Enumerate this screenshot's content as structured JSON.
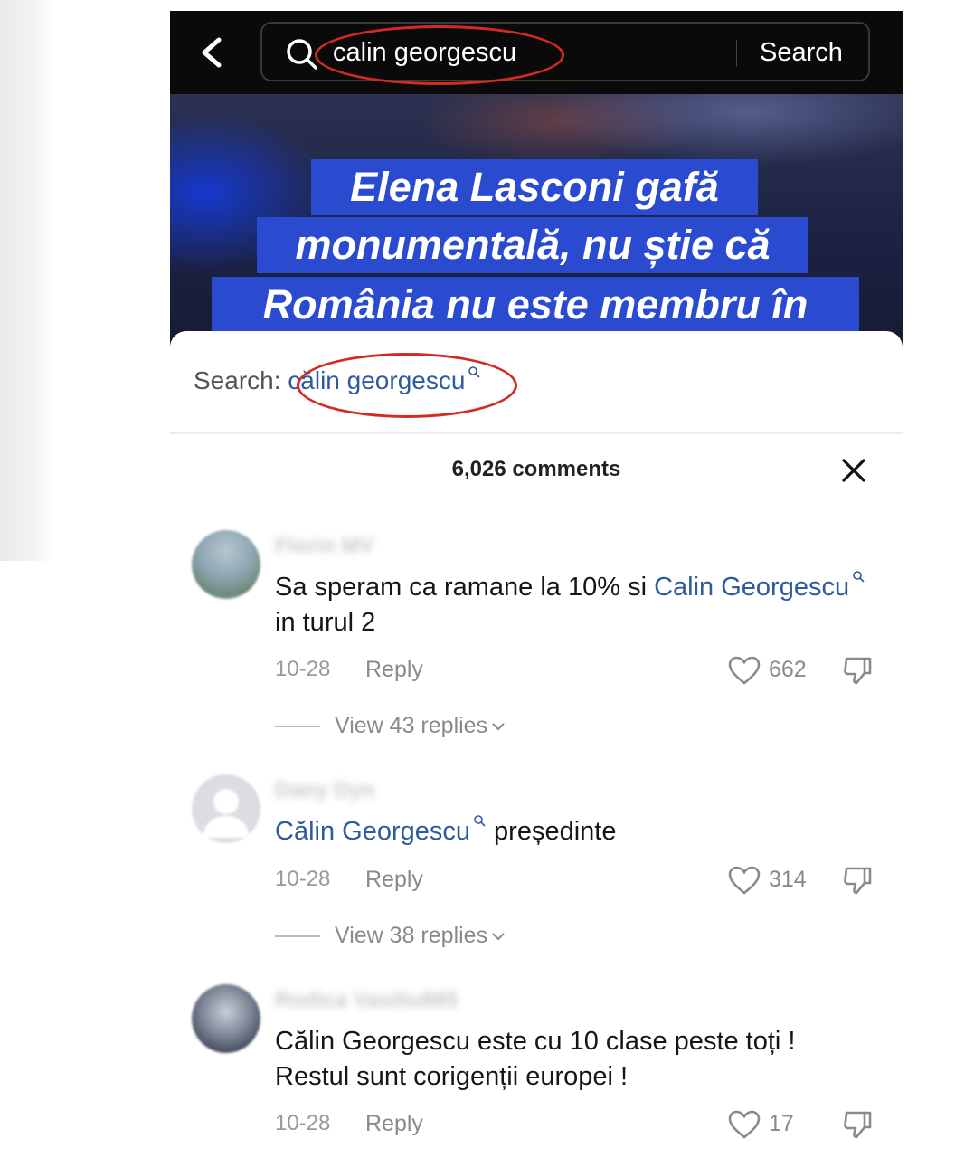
{
  "search": {
    "query": "calin georgescu",
    "button_label": "Search"
  },
  "video": {
    "caption_lines": [
      "Elena Lasconi gafă",
      "monumentală, nu știe că",
      "România nu este membru în"
    ]
  },
  "sheet": {
    "related_label": "Search:",
    "related_term": "călin georgescu",
    "comments_count": "6,026 comments"
  },
  "comments": [
    {
      "username": "Florin MV",
      "text_before": "Sa speram ca ramane la 10% si ",
      "link": "Calin Georgescu",
      "text_after": " in turul 2",
      "date": "10-28",
      "reply_label": "Reply",
      "likes": "662",
      "view_replies": "View 43 replies"
    },
    {
      "username": "Dany Dyn",
      "text_before": "",
      "link": "Călin Georgescu",
      "text_after": " președinte",
      "date": "10-28",
      "reply_label": "Reply",
      "likes": "314",
      "view_replies": "View 38 replies"
    },
    {
      "username": "Rodica Vasiliu885",
      "text_line1": "Călin Georgescu este cu 10 clase peste toți !",
      "text_line2": "Restul sunt corigenții europei !",
      "date": "10-28",
      "reply_label": "Reply",
      "likes": "17"
    }
  ],
  "colors": {
    "highlight_circle": "#d42a24",
    "link": "#2f5a9e",
    "caption_bg": "#2a4ad0",
    "topbar_bg": "#0a0a0a"
  },
  "icons": [
    "back-icon",
    "search-icon",
    "close-icon",
    "heart-icon",
    "dislike-icon",
    "chevron-down-icon"
  ]
}
